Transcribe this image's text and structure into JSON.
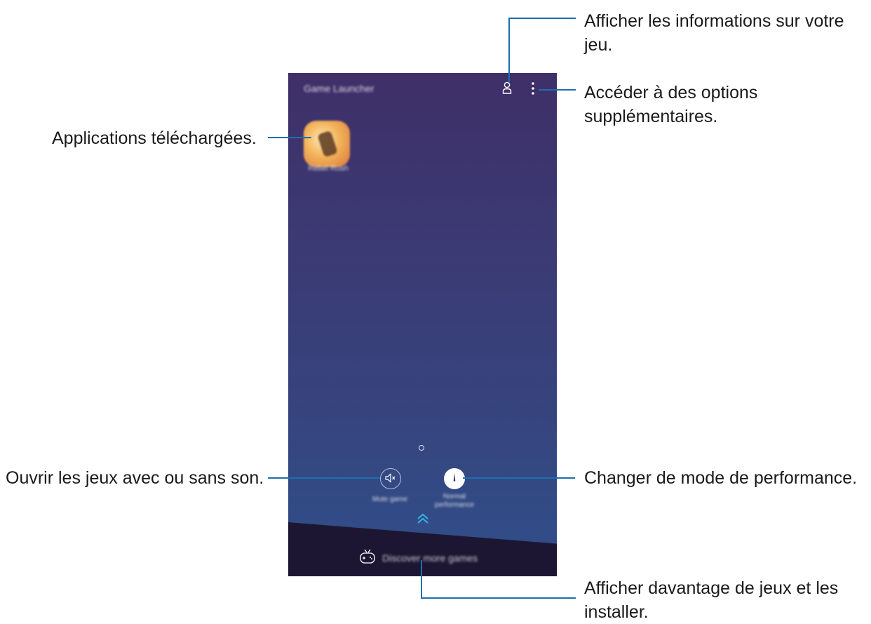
{
  "screen": {
    "app_title": "Game Launcher",
    "app_label": "Rebel Rush",
    "mute_label": "Mute game",
    "perf_label": "Normal performance",
    "discover_label": "Discover more games",
    "icons": [
      "profile-icon",
      "more-options-icon",
      "mute-icon",
      "performance-icon",
      "chevron-up-icon",
      "gamepad-icon"
    ]
  },
  "callouts": {
    "game_info": "Afficher les informations sur votre jeu.",
    "more_options": "Accéder à des options supplémentaires.",
    "downloaded_apps": "Applications téléchargées.",
    "sound": "Ouvrir les jeux avec ou sans son.",
    "performance": "Changer de mode de performance.",
    "discover": "Afficher davantage de jeux et les installer."
  },
  "colors": {
    "callout_line": "#1e6fb0",
    "screen_top": "#3f2f68",
    "screen_bottom": "#2f4f8a",
    "bottom_bar": "#1d1633"
  }
}
